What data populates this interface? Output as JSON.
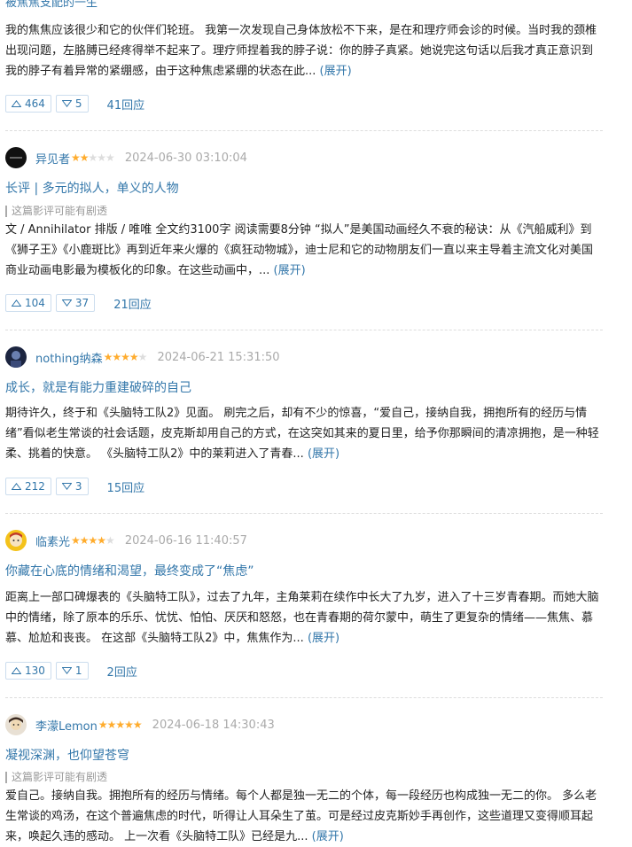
{
  "top_title": "被焦焦支配的一生",
  "reviews": [
    {
      "title": "",
      "author": "",
      "stars": 0,
      "date": "",
      "spoiler": "",
      "body": "我的焦焦应该很少和它的伙伴们轮班。 我第一次发现自己身体放松不下来，是在和理疗师会诊的时候。当时我的颈椎出现问题，左胳膊已经疼得举不起来了。理疗师捏着我的脖子说：你的脖子真紧。她说完这句话以后我才真正意识到我的脖子有着异常的紧绷感，由于这种焦虑紧绷的状态在此...",
      "expand": "(展开)",
      "up": "464",
      "down": "5",
      "replies": "41回应"
    },
    {
      "author": "异见者",
      "stars": 2,
      "date": "2024-06-30 03:10:04",
      "title": "长评 | 多元的拟人，单义的人物",
      "spoiler": "这篇影评可能有剧透",
      "body": "文 / Annihilator 排版 / 唯唯 全文约3100字 阅读需要8分钟 “拟人”是美国动画经久不衰的秘诀：从《汽船威利》到《狮子王》《小鹿斑比》再到近年来火爆的《疯狂动物城》，迪士尼和它的动物朋友们一直以来主导着主流文化对美国商业动画电影最为模板化的印象。在这些动画中，...",
      "expand": "(展开)",
      "up": "104",
      "down": "37",
      "replies": "21回应"
    },
    {
      "author": "nothing纳森",
      "stars": 4,
      "date": "2024-06-21 15:31:50",
      "title": "成长，就是有能力重建破碎的自己",
      "spoiler": "",
      "body": "期待许久，终于和《头脑特工队2》见面。 刷完之后，却有不少的惊喜，“爱自己，接纳自我，拥抱所有的经历与情绪”看似老生常谈的社会话题，皮克斯却用自己的方式，在这突如其来的夏日里，给予你那瞬间的清凉拥抱，是一种轻柔、挑着的快意。 《头脑特工队2》中的莱莉进入了青春...",
      "expand": "(展开)",
      "up": "212",
      "down": "3",
      "replies": "15回应"
    },
    {
      "author": "临素光",
      "stars": 4,
      "date": "2024-06-16 11:40:57",
      "title": "你藏在心底的情绪和渴望，最终变成了“焦虑”",
      "spoiler": "",
      "body": "距离上一部口碑爆表的《头脑特工队》，过去了九年，主角莱莉在续作中长大了九岁，进入了十三岁青春期。而她大脑中的情绪，除了原本的乐乐、忧忧、怕怕、厌厌和怒怒，也在青春期的荷尔蒙中，萌生了更复杂的情绪——焦焦、慕慕、尬尬和丧丧。 在这部《头脑特工队2》中，焦焦作为...",
      "expand": "(展开)",
      "up": "130",
      "down": "1",
      "replies": "2回应"
    },
    {
      "author": "李濛Lemon",
      "stars": 5,
      "date": "2024-06-18 14:30:43",
      "title": "凝视深渊，也仰望苍穹",
      "spoiler": "这篇影评可能有剧透",
      "body": "爱自己。接纳自我。拥抱所有的经历与情绪。每个人都是独一无二的个体，每一段经历也构成独一无二的你。 多么老生常谈的鸡汤，在这个普遍焦虑的时代，听得让人耳朵生了茧。可是经过皮克斯妙手再创作，这些道理又变得顺耳起来，唤起久违的感动。 上一次看《头脑特工队》已经是九...",
      "expand": "(展开)",
      "up": "",
      "down": "",
      "replies": ""
    }
  ],
  "colors": {
    "link": "#3377aa",
    "star": "#ffac2d",
    "muted": "#aaaaaa"
  }
}
